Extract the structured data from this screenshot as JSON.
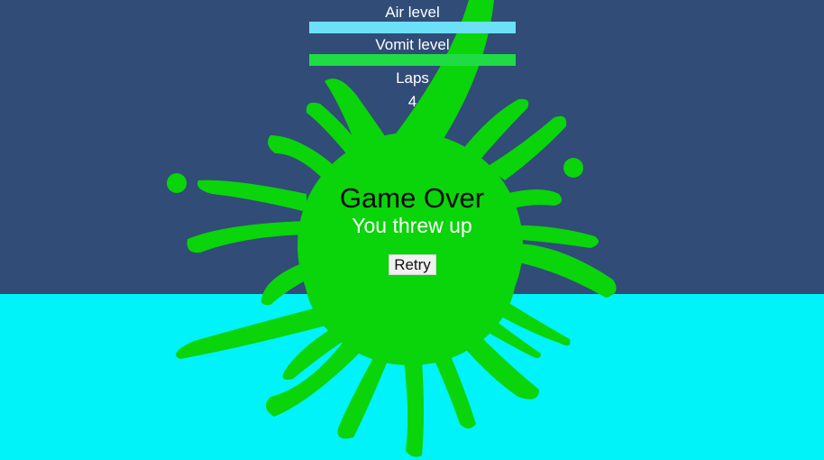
{
  "colors": {
    "sky": "#304c77",
    "water": "#00f3f9",
    "splat": "#0ad40a",
    "air_bar": "#6be0f7",
    "vomit_bar": "#1fdc45"
  },
  "hud": {
    "air_label": "Air level",
    "air_level": 1.0,
    "vomit_label": "Vomit level",
    "vomit_level": 1.0,
    "laps_label": "Laps",
    "laps_value": "4"
  },
  "game_over": {
    "title": "Game Over",
    "subtitle": "You threw up",
    "retry_label": "Retry"
  }
}
